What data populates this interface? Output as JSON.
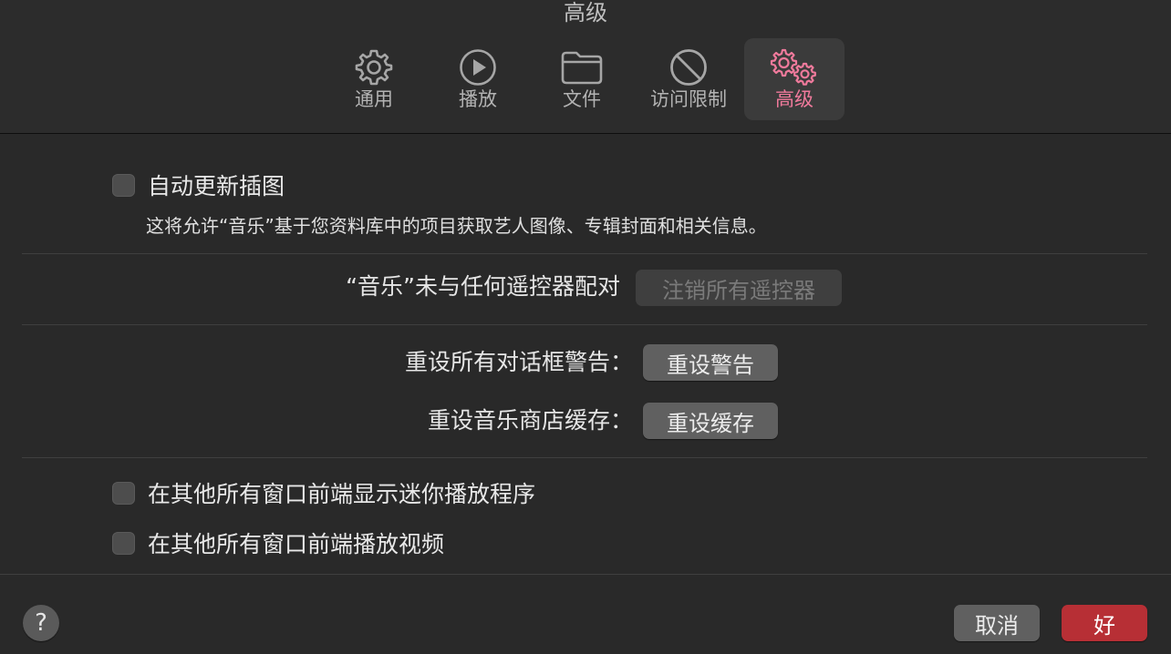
{
  "window": {
    "title": "高级"
  },
  "tabs": [
    {
      "label": "通用",
      "icon": "gear-icon"
    },
    {
      "label": "播放",
      "icon": "play-circle-icon"
    },
    {
      "label": "文件",
      "icon": "folder-icon"
    },
    {
      "label": "访问限制",
      "icon": "prohibited-icon"
    },
    {
      "label": "高级",
      "icon": "gears-icon",
      "active": true
    }
  ],
  "artwork": {
    "checkbox_label": "自动更新插图",
    "checked": false,
    "description": "这将允许“音乐”基于您资料库中的项目获取艺人图像、专辑封面和相关信息。"
  },
  "remotes": {
    "status": "“音乐”未与任何遥控器配对",
    "button": "注销所有遥控器"
  },
  "reset_warnings": {
    "label": "重设所有对话框警告：",
    "button": "重设警告"
  },
  "reset_cache": {
    "label": "重设音乐商店缓存：",
    "button": "重设缓存"
  },
  "options": [
    {
      "label": "在其他所有窗口前端显示迷你播放程序",
      "checked": false
    },
    {
      "label": "在其他所有窗口前端播放视频",
      "checked": false
    }
  ],
  "footer": {
    "help": "?",
    "cancel": "取消",
    "ok": "好"
  },
  "colors": {
    "accent": "#f07a9c",
    "primary_button": "#b72f35"
  }
}
